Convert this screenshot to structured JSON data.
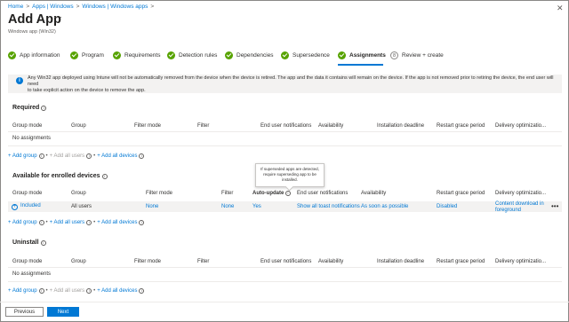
{
  "breadcrumb": [
    "Home",
    "Apps | Windows",
    "Windows | Windows apps"
  ],
  "page": {
    "title": "Add App",
    "subtitle": "Windows app (Win32)"
  },
  "wizard": {
    "steps": [
      {
        "label": "App information",
        "state": "done"
      },
      {
        "label": "Program",
        "state": "done"
      },
      {
        "label": "Requirements",
        "state": "done"
      },
      {
        "label": "Detection rules",
        "state": "done"
      },
      {
        "label": "Dependencies",
        "state": "done"
      },
      {
        "label": "Supersedence",
        "state": "done"
      },
      {
        "label": "Assignments",
        "state": "active"
      },
      {
        "label": "Review + create",
        "state": "pending",
        "number": "8"
      }
    ]
  },
  "info_banner": {
    "line1": "Any Win32 app deployed using Intune will not be automatically removed from the device when the device is retired. The app and the data it contains will remain on the device. If the app is not removed prior to retiring the device, the end user will need",
    "line2": "to take explicit action on the device to remove the app."
  },
  "sections": {
    "required": {
      "title": "Required",
      "columns": [
        "Group mode",
        "Group",
        "Filter mode",
        "Filter",
        "End user notifications",
        "Availability",
        "Installation deadline",
        "Restart grace period",
        "Delivery optimizatio..."
      ],
      "empty": "No assignments",
      "add_group": "+ Add group",
      "add_all_users": "+ Add all users",
      "add_all_devices": "+ Add all devices"
    },
    "available": {
      "title": "Available for enrolled devices",
      "columns": [
        "Group mode",
        "Group",
        "Filter mode",
        "Filter",
        "Auto-update",
        "End user notifications",
        "Availability",
        "Restart grace period",
        "Delivery optimizatio..."
      ],
      "row": {
        "group_mode": "Included",
        "group": "All users",
        "filter_mode": "None",
        "filter": "None",
        "auto_update": "Yes",
        "notifications": "Show all toast notifications",
        "availability": "As soon as possible",
        "restart": "Disabled",
        "delivery_line1": "Content download in",
        "delivery_line2": "foreground",
        "more": "•••"
      },
      "tooltip": "If superseded apps are detected, require superseding app to be installed.",
      "add_group": "+ Add group",
      "add_all_users": "+ Add all users",
      "add_all_devices": "+ Add all devices"
    },
    "uninstall": {
      "title": "Uninstall",
      "columns": [
        "Group mode",
        "Group",
        "Filter mode",
        "Filter",
        "End user notifications",
        "Availability",
        "Installation deadline",
        "Restart grace period",
        "Delivery optimizatio..."
      ],
      "empty": "No assignments",
      "add_group": "+ Add group",
      "add_all_users": "+ Add all users",
      "add_all_devices": "+ Add all devices"
    }
  },
  "footer": {
    "previous": "Previous",
    "next": "Next"
  },
  "colors": {
    "accent": "#0078d4",
    "success": "#57a300"
  }
}
